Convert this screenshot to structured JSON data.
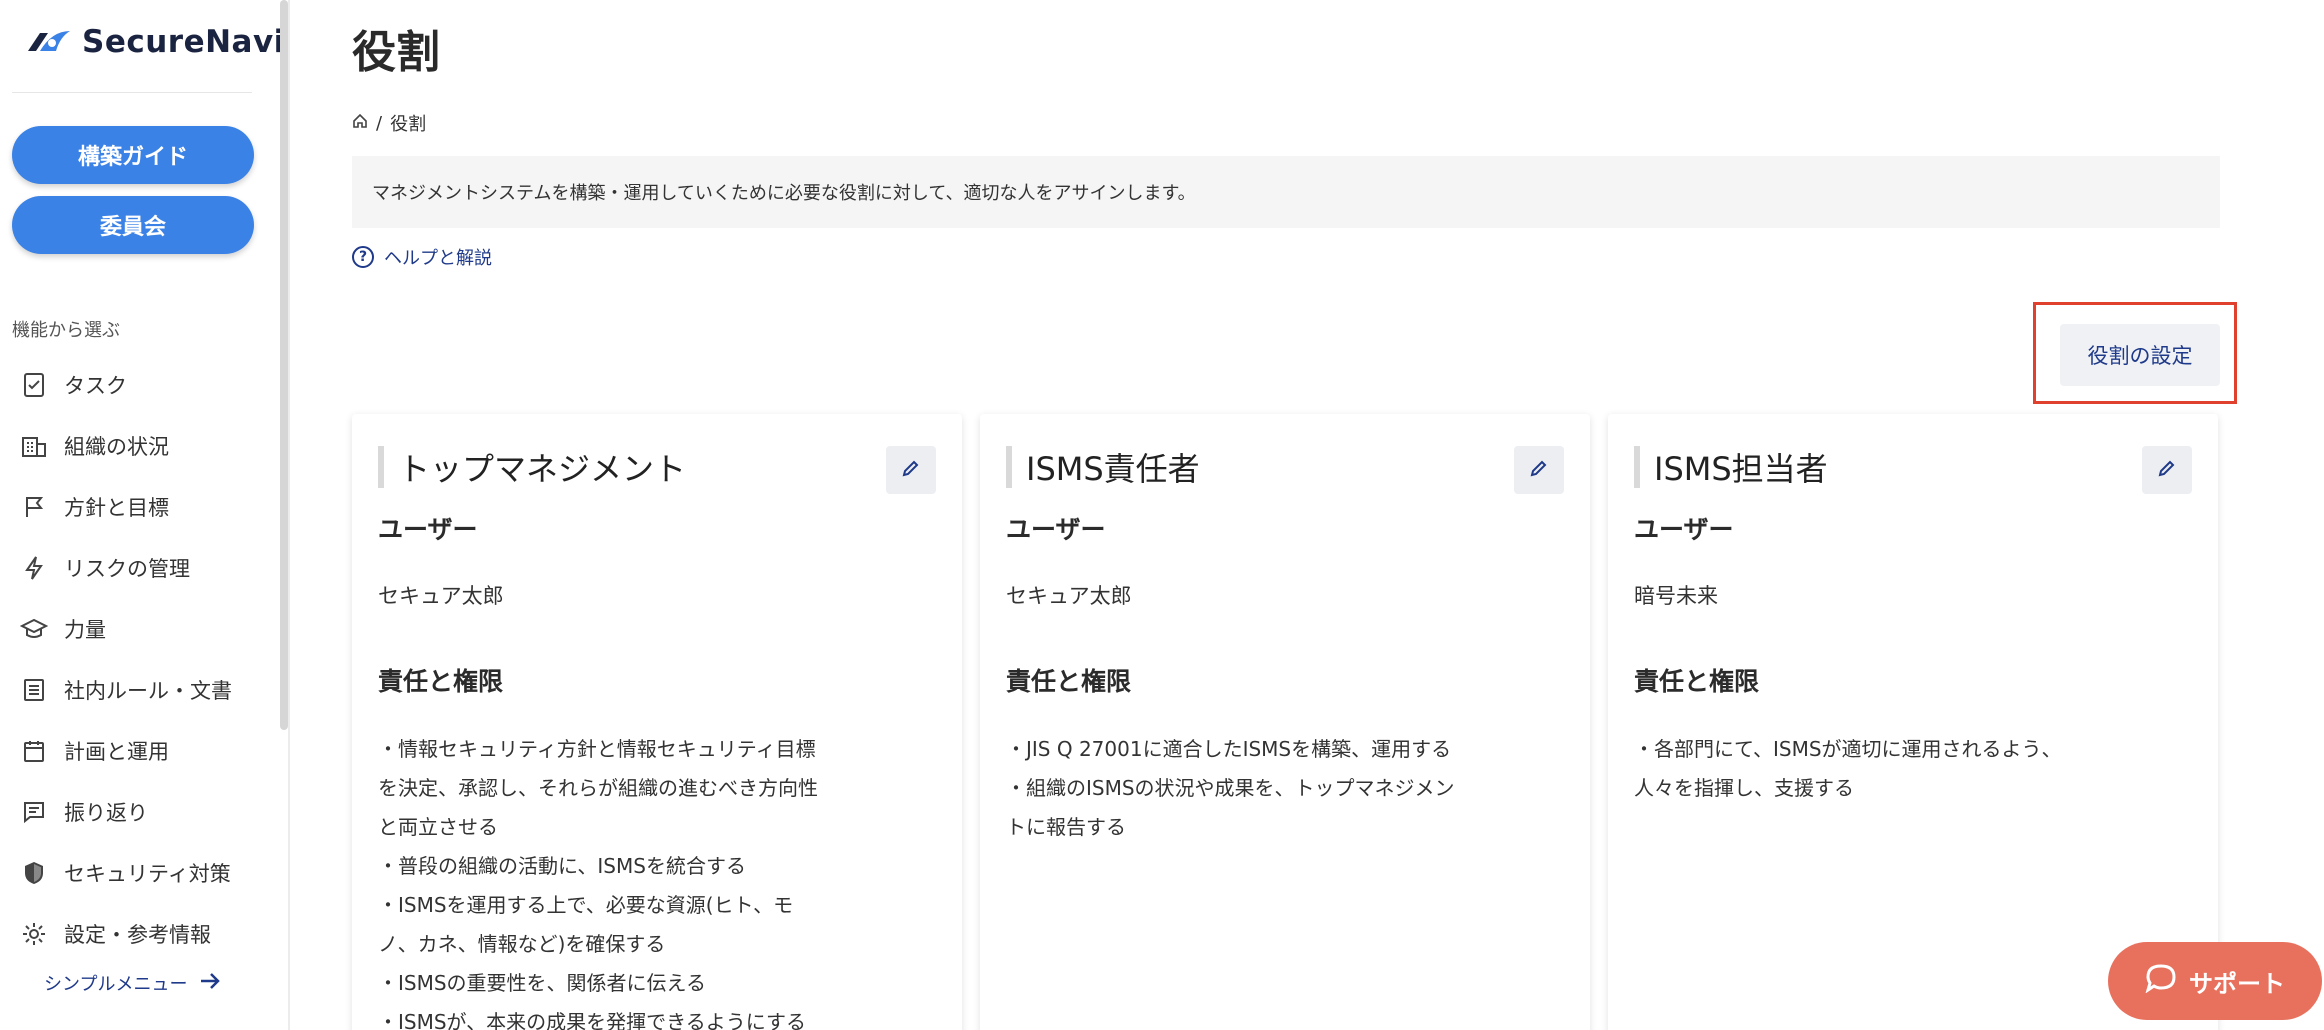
{
  "sidebar": {
    "logo_text": "SecureNavi",
    "buttons": {
      "guide": "構築ガイド",
      "committee": "委員会"
    },
    "section_label": "機能から選ぶ",
    "items": [
      {
        "label": "タスク",
        "icon": "task-icon"
      },
      {
        "label": "組織の状況",
        "icon": "building-icon"
      },
      {
        "label": "方針と目標",
        "icon": "flag-icon"
      },
      {
        "label": "リスクの管理",
        "icon": "lightning-icon"
      },
      {
        "label": "力量",
        "icon": "graduation-cap-icon"
      },
      {
        "label": "社内ルール・文書",
        "icon": "document-icon"
      },
      {
        "label": "計画と運用",
        "icon": "calendar-icon"
      },
      {
        "label": "振り返り",
        "icon": "comment-icon"
      },
      {
        "label": "セキュリティ対策",
        "icon": "shield-icon"
      },
      {
        "label": "設定・参考情報",
        "icon": "gear-icon"
      }
    ],
    "simple_menu": "シンプルメニュー"
  },
  "main": {
    "title": "役割",
    "breadcrumb": {
      "current": "役割"
    },
    "description": "マネジメントシステムを構築・運用していくために必要な役割に対して、適切な人をアサインします。",
    "help_link": "ヘルプと解説",
    "role_setting_button": "役割の設定",
    "user_heading": "ユーザー",
    "responsibility_heading": "責任と権限",
    "cards": [
      {
        "title": "トップマネジメント",
        "user": "セキュア太郎",
        "responsibilities": [
          "・情報セキュリティ方針と情報セキュリティ目標",
          "を決定、承認し、それらが組織の進むべき方向性",
          "と両立させる",
          "・普段の組織の活動に、ISMSを統合する",
          "・ISMSを運用する上で、必要な資源(ヒト、モ",
          "ノ、カネ、情報など)を確保する",
          "・ISMSの重要性を、関係者に伝える",
          "・ISMSが、本来の成果を発揮できるようにする"
        ]
      },
      {
        "title": "ISMS責任者",
        "user": "セキュア太郎",
        "responsibilities": [
          "・JIS Q 27001に適合したISMSを構築、運用する",
          "・組織のISMSの状況や成果を、トップマネジメン",
          "トに報告する"
        ]
      },
      {
        "title": "ISMS担当者",
        "user": "暗号未来",
        "responsibilities": [
          "・各部門にて、ISMSが適切に運用されるよう、",
          "人々を指揮し、支援する"
        ]
      }
    ]
  },
  "support_button": "サポート",
  "colors": {
    "primary_blue": "#3b82e6",
    "link_navy": "#1f3a8a",
    "highlight_red": "#e0412f",
    "support_orange": "#e8715e"
  }
}
